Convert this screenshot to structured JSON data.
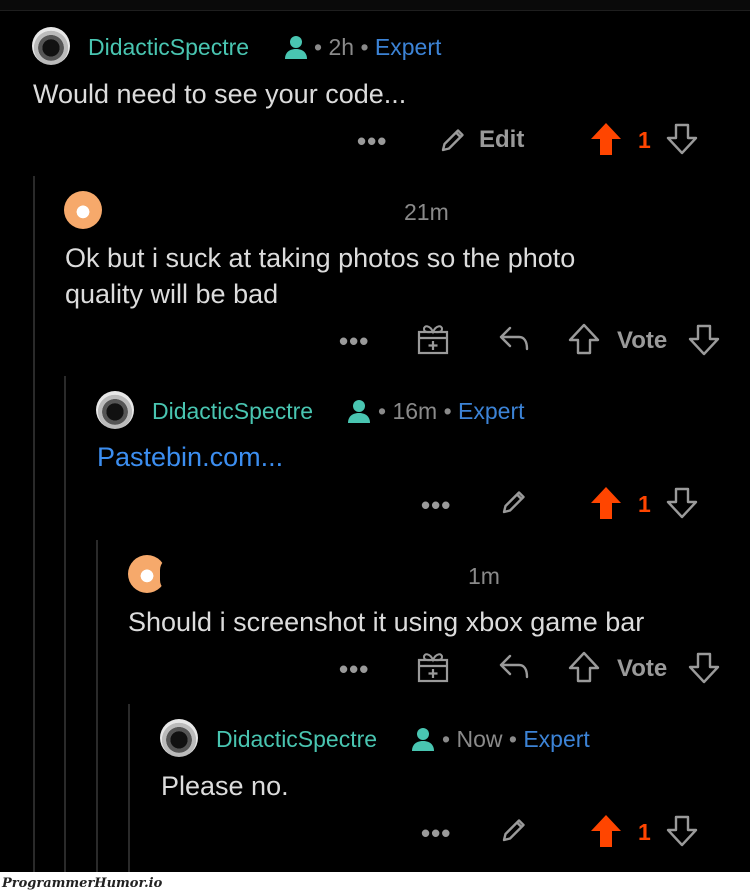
{
  "comments": [
    {
      "author": "DidacticSpectre",
      "time": "2h",
      "flair": "Expert",
      "body": "Would need to see your code...",
      "edit_label": "Edit",
      "votes": "1"
    },
    {
      "time": "21m",
      "body_line1": "Ok but i suck at taking photos so the photo",
      "body_line2": "quality will be bad",
      "vote_label": "Vote"
    },
    {
      "author": "DidacticSpectre",
      "time": "16m",
      "flair": "Expert",
      "body": "Pastebin.com...",
      "votes": "1"
    },
    {
      "time": "1m",
      "body": "Should i screenshot it using xbox game bar",
      "vote_label": "Vote"
    },
    {
      "author": "DidacticSpectre",
      "time": "Now",
      "flair": "Expert",
      "body": "Please no.",
      "votes": "1"
    }
  ],
  "separator": "•",
  "more_label": "•••",
  "colors": {
    "author": "#49c5b1",
    "flair": "#3c83d6",
    "upvote": "#ff4500",
    "link": "#3c8ef0"
  },
  "icons": [
    "person-icon",
    "more-icon",
    "pencil-icon",
    "upvote-icon",
    "downvote-icon",
    "award-icon",
    "reply-icon"
  ],
  "watermark": "ProgrammerHumor.io"
}
